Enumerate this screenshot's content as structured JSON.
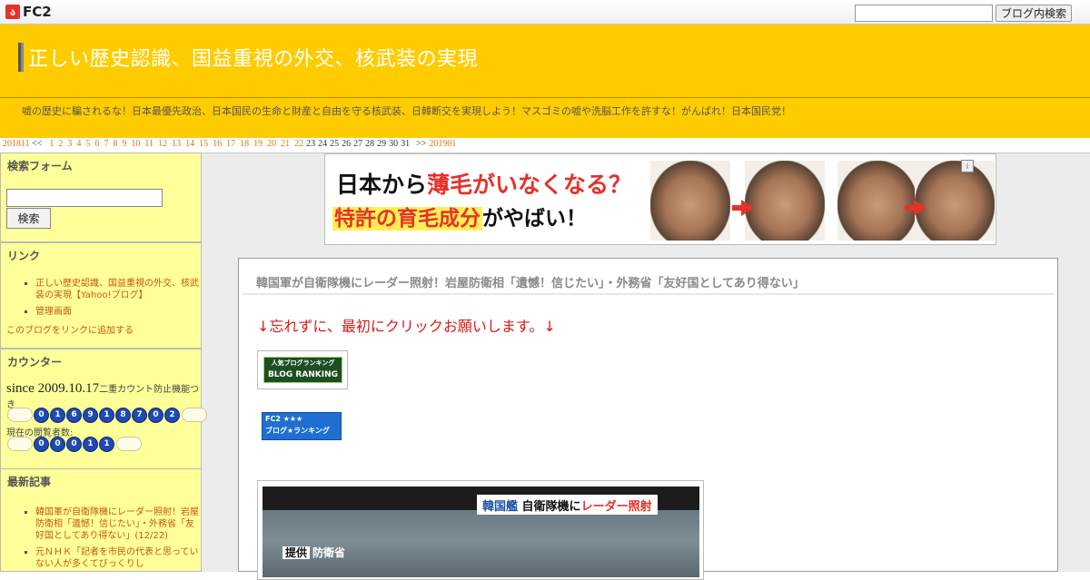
{
  "fc2bar": {
    "logo_mark": "ა",
    "logo_text": "FC2",
    "search_placeholder": "",
    "search_button": "ブログ内検索"
  },
  "header": {
    "title": "正しい歴史認識、国益重視の外交、核武装の実現",
    "description": "嘘の歴史に騙されるな！日本最優先政治、日本国民の生命と財産と自由を守る核武装、日韓断交を実現しよう！マスゴミの嘘や洗脳工作を許すな！がんばれ！日本国民党！"
  },
  "calendar": {
    "prev_month": "201811",
    "prev_arrow": "<<",
    "linked_days": [
      "1",
      "2",
      "3",
      "4",
      "5",
      "6",
      "7",
      "8",
      "9",
      "10",
      "11",
      "12",
      "13",
      "14",
      "15",
      "16",
      "17",
      "18",
      "19",
      "20",
      "21",
      "22"
    ],
    "plain_days": [
      "23",
      "24",
      "25",
      "26",
      "27",
      "28",
      "29",
      "30",
      "31"
    ],
    "next_arrow": ">>",
    "next_month": "201901"
  },
  "sidebar": {
    "search": {
      "title": "検索フォーム",
      "input_value": "",
      "button": "検索"
    },
    "links": {
      "title": "リンク",
      "items": [
        "正しい歴史認識、国益重視の外交、核武装の実現【Yahoo!ブログ】",
        "管理画面"
      ],
      "add_link": "このブログをリンクに追加する"
    },
    "counter": {
      "title": "カウンター",
      "since": "since 2009.10.17",
      "note": "二重カウント防止機能つき",
      "total_digits": [
        "0",
        "1",
        "6",
        "9",
        "1",
        "8",
        "7",
        "0",
        "2"
      ],
      "current_label": "現在の閲覧者数:",
      "current_digits": [
        "0",
        "0",
        "0",
        "1",
        "1"
      ]
    },
    "recent": {
      "title": "最新記事",
      "items": [
        "韓国軍が自衛隊機にレーダー照射！岩屋防衛相「遺憾！信じたい」・外務省「友好国としてあり得ない」(12/22)",
        "元ＮＨＫ「記者を市民の代表と思っていない人が多くてびっくりし"
      ]
    }
  },
  "banner": {
    "line1_prefix": "日本から",
    "line1_red": "薄毛がいなくなる？",
    "line2_highlight": "特許の育毛成分",
    "line2_suffix": "がやばい！",
    "ad_badge": "i"
  },
  "entry": {
    "title": "韓国軍が自衛隊機にレーダー照射！岩屋防衛相「遺憾！信じたい」・外務省「友好国としてあり得ない」",
    "lead": "↓忘れずに、最初にクリックお願いします。↓",
    "rank1_top": "人気ブログランキング",
    "rank1_bottom": "BLOG RANKING",
    "rank2_top": "FC2 ★★★",
    "rank2_bottom": "ブログ★ランキング",
    "image_caption_blue": "韓国艦",
    "image_caption_mid": "自衛隊機に",
    "image_caption_red": "レーダー照射",
    "image_credit_label": "提供",
    "image_credit": "防衛省"
  },
  "colors": {
    "header_yellow": "#ffcc00",
    "sidebar_yellow": "#ffff99",
    "link_orange": "#c15a0d",
    "lead_red": "#d41a1a"
  }
}
